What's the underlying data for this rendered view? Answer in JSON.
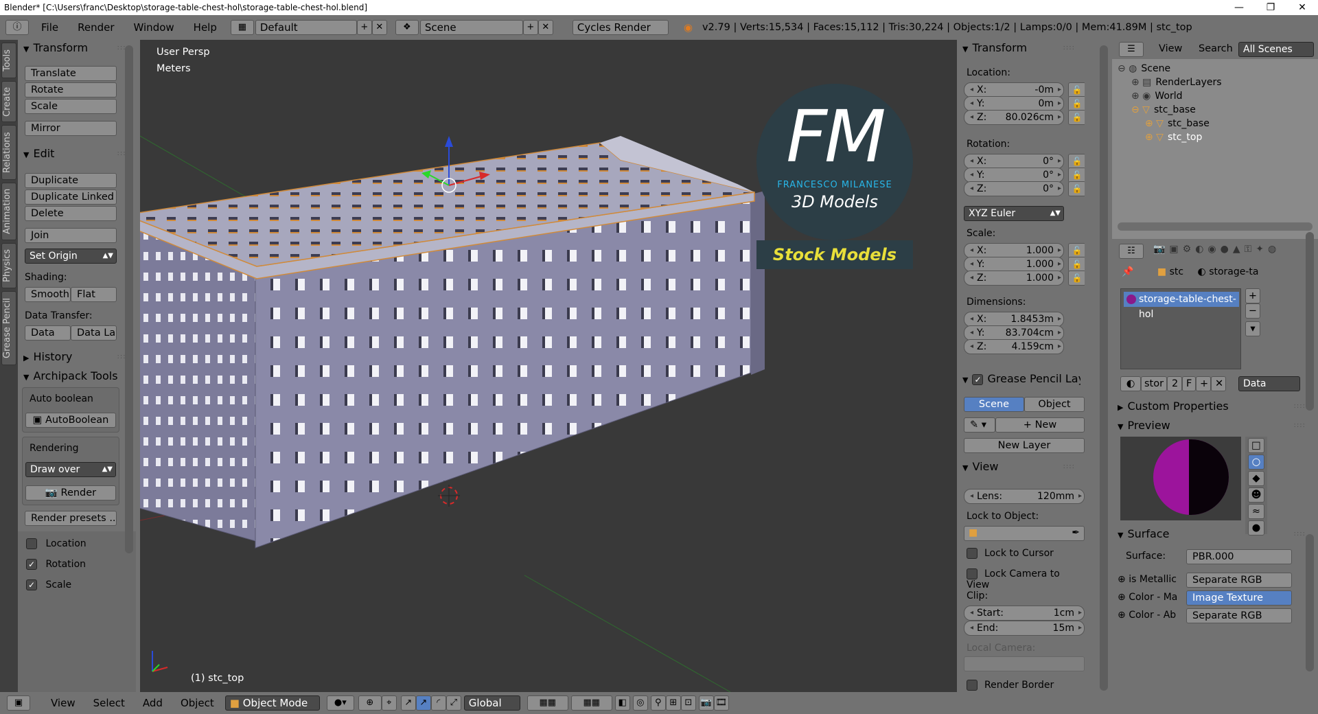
{
  "window": {
    "title": "Blender* [C:\\Users\\franc\\Desktop\\storage-table-chest-hol\\storage-table-chest-hol.blend]",
    "minimize": "—",
    "maximize": "❐",
    "close": "✕"
  },
  "topbar": {
    "info_icon": "ⓘ",
    "menus": [
      "File",
      "Render",
      "Window",
      "Help"
    ],
    "layout": "Default",
    "scene": "Scene",
    "engine": "Cycles Render",
    "stats": "v2.79 | Verts:15,534 | Faces:15,112 | Tris:30,224 | Objects:1/2 | Lamps:0/0 | Mem:41.89M | stc_top"
  },
  "tabs": [
    "Tools",
    "Create",
    "Relations",
    "Animation",
    "Physics",
    "Grease Pencil"
  ],
  "toolshelf": {
    "transform_header": "Transform",
    "transform": [
      "Translate",
      "Rotate",
      "Scale"
    ],
    "mirror": "Mirror",
    "edit_header": "Edit",
    "edit": [
      "Duplicate",
      "Duplicate Linked",
      "Delete"
    ],
    "join": "Join",
    "set_origin": "Set Origin",
    "shading_label": "Shading:",
    "smooth": "Smooth",
    "flat": "Flat",
    "data_transfer_label": "Data Transfer:",
    "data": "Data",
    "data_la": "Data La",
    "history_header": "History",
    "archipack_header": "Archipack Tools",
    "auto_boolean_label": "Auto boolean",
    "auto_boolean_btn": "AutoBoolean",
    "rendering_label": "Rendering",
    "draw_over": "Draw over",
    "render_btn": "Render",
    "render_presets": "Render presets ...",
    "checks": [
      {
        "label": "Location",
        "checked": false
      },
      {
        "label": "Rotation",
        "checked": true
      },
      {
        "label": "Scale",
        "checked": true
      }
    ]
  },
  "viewport": {
    "view_name": "User Persp",
    "units": "Meters",
    "object_label": "(1) stc_top",
    "logo_letters": "FM",
    "logo_name": "FRANCESCO MILANESE",
    "logo_sub": "3D Models",
    "logo_banner": "Stock Models"
  },
  "npanel": {
    "transform_header": "Transform",
    "location_label": "Location:",
    "location": [
      {
        "axis": "X:",
        "value": "-0m"
      },
      {
        "axis": "Y:",
        "value": "0m"
      },
      {
        "axis": "Z:",
        "value": "80.026cm"
      }
    ],
    "rotation_label": "Rotation:",
    "rotation": [
      {
        "axis": "X:",
        "value": "0°"
      },
      {
        "axis": "Y:",
        "value": "0°"
      },
      {
        "axis": "Z:",
        "value": "0°"
      }
    ],
    "euler": "XYZ Euler",
    "scale_label": "Scale:",
    "scale": [
      {
        "axis": "X:",
        "value": "1.000"
      },
      {
        "axis": "Y:",
        "value": "1.000"
      },
      {
        "axis": "Z:",
        "value": "1.000"
      }
    ],
    "dimensions_label": "Dimensions:",
    "dimensions": [
      {
        "axis": "X:",
        "value": "1.8453m"
      },
      {
        "axis": "Y:",
        "value": "83.704cm"
      },
      {
        "axis": "Z:",
        "value": "4.159cm"
      }
    ],
    "gp_header": "Grease Pencil Layer",
    "gp_scene": "Scene",
    "gp_object": "Object",
    "gp_new": "New",
    "gp_new_layer": "New Layer",
    "view_header": "View",
    "lens_label": "Lens:",
    "lens": "120mm",
    "lock_object_label": "Lock to Object:",
    "lock_cursor": "Lock to Cursor",
    "lock_camera": "Lock Camera to View",
    "clip_label": "Clip:",
    "clip_start_label": "Start:",
    "clip_start": "1cm",
    "clip_end_label": "End:",
    "clip_end": "15m",
    "local_camera_label": "Local Camera:",
    "render_border": "Render Border"
  },
  "outliner": {
    "view": "View",
    "search": "Search",
    "filter": "All Scenes",
    "items": [
      {
        "label": "Scene",
        "indent": 0
      },
      {
        "label": "RenderLayers",
        "indent": 1
      },
      {
        "label": "World",
        "indent": 1
      },
      {
        "label": "stc_base",
        "indent": 1
      },
      {
        "label": "stc_base",
        "indent": 2
      },
      {
        "label": "stc_top",
        "indent": 2
      }
    ]
  },
  "properties": {
    "breadcrumb_obj": "stc",
    "breadcrumb_mat": "storage-ta",
    "material_slot": "storage-table-chest-hol",
    "mat_name": "stor",
    "mat_users": "2",
    "mat_fake": "F",
    "data_dropdown": "Data",
    "custom_props": "Custom Properties",
    "preview": "Preview",
    "surface_header": "Surface",
    "surface_label": "Surface:",
    "surface_value": "PBR.000",
    "rows": [
      {
        "label": "is Metallic",
        "value": "Separate RGB",
        "active": false
      },
      {
        "label": "Color - Ma",
        "value": "Image Texture",
        "active": true
      },
      {
        "label": "Color - Ab",
        "value": "Separate RGB",
        "active": false
      }
    ]
  },
  "bottombar": {
    "view": "View",
    "select": "Select",
    "add": "Add",
    "object": "Object",
    "mode": "Object Mode",
    "orientation": "Global"
  },
  "colors": {
    "panel": "#727272",
    "viewport": "#393939",
    "selected_blue": "#5680c2",
    "logo_yellow": "#e8df3a",
    "logo_circle": "#2c3e46"
  }
}
